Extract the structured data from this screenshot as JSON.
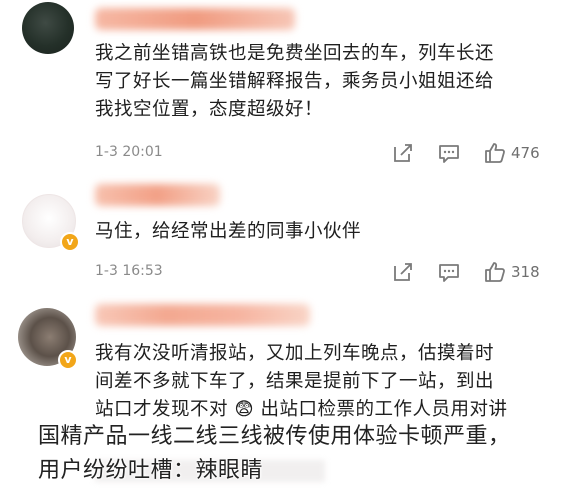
{
  "comments": [
    {
      "username": "",
      "text_line1": "我之前坐错高铁也是免费坐回去的车，列车长还",
      "text_line2": "写了好长一篇坐错解释报告，乘务员小姐姐还给",
      "text_line3": "我找空位置，态度超级好！",
      "time": "1-3 20:01",
      "likes": "476"
    },
    {
      "username": "",
      "text_line1": "马住，给经常出差的同事小伙伴",
      "time": "1-3 16:53",
      "likes": "318"
    },
    {
      "username": "",
      "text_line1": "我有次没听清报站，又加上列车晚点，估摸着时",
      "text_line2": "间差不多就下车了，结果是提前下了一站，到出",
      "text_line3": "站口才发现不对 😨 出站口检票的工作人员用对讲"
    }
  ],
  "caption": {
    "line1": "国精产品一线二线三线被传使用体验卡顿严重，",
    "line2": "用户纷纷吐槽：辣眼睛"
  },
  "icons": {
    "share": "share-icon",
    "comment": "comment-icon",
    "like": "thumbs-up-icon",
    "verified": "verified-badge-icon"
  },
  "colors": {
    "text": "#1f1f1f",
    "meta": "#8a8a8a",
    "username_blur": "#f4a48a",
    "verified": "#f2a619"
  }
}
